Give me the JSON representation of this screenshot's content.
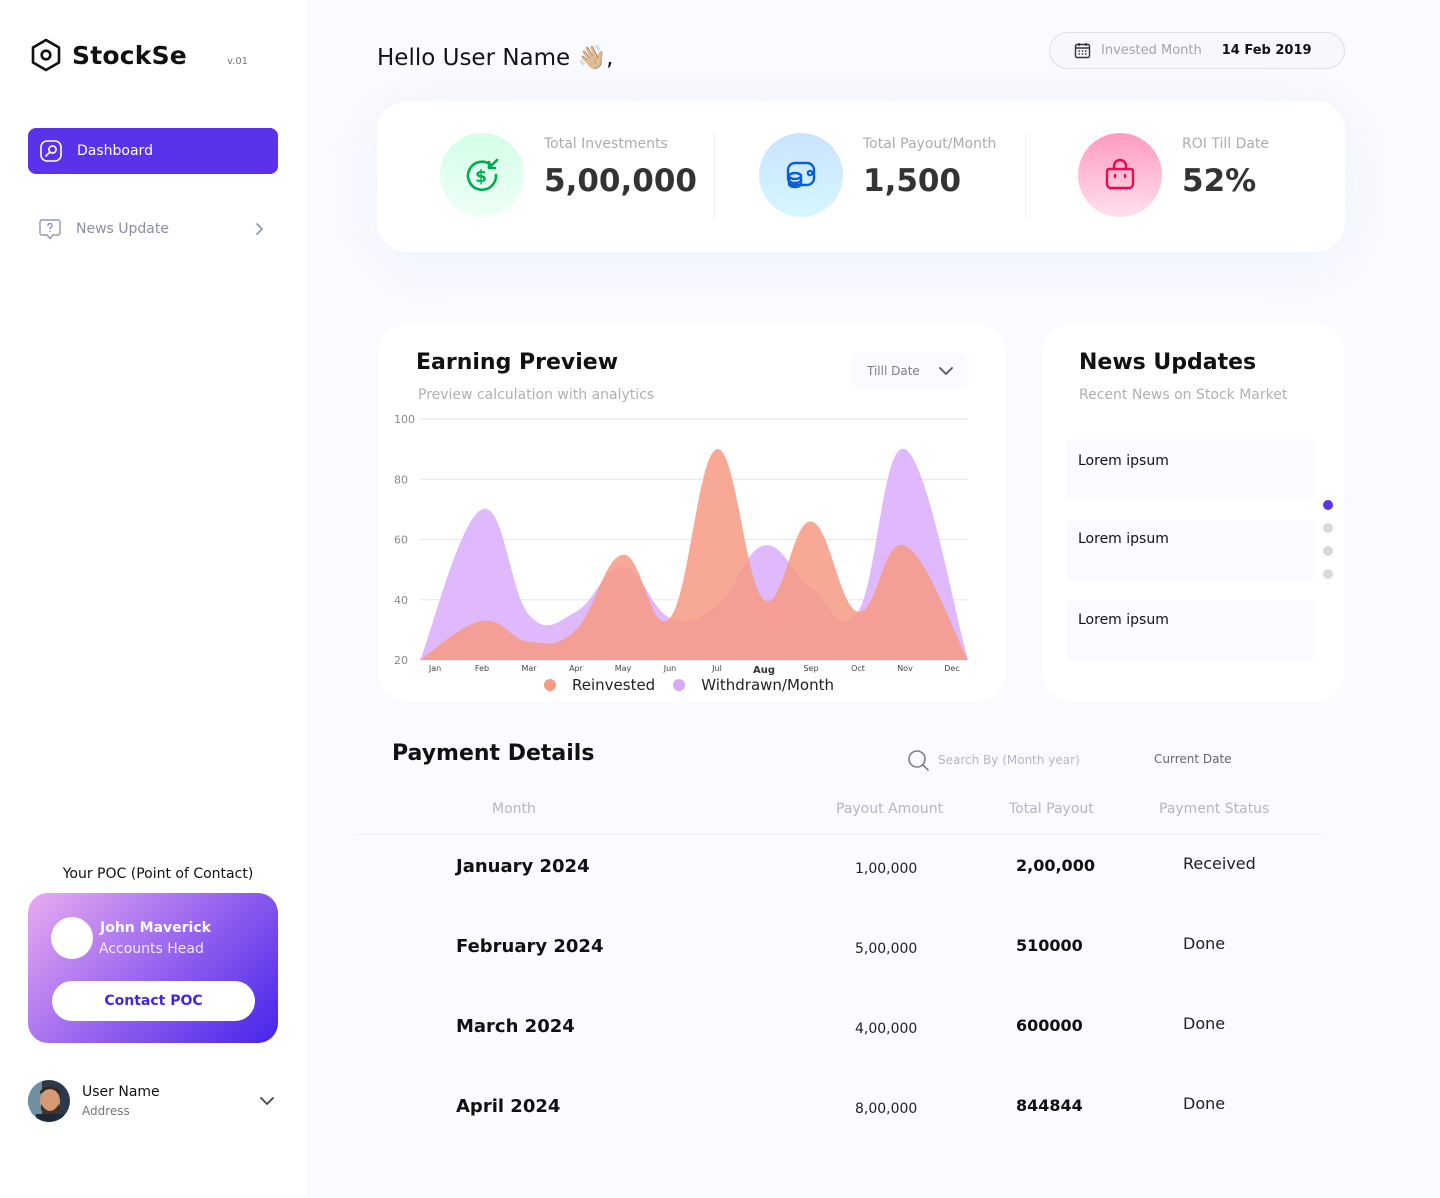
{
  "app": {
    "name": "StockSe",
    "version": "v.01"
  },
  "sidebar": {
    "items": [
      {
        "label": "Dashboard",
        "icon": "dashboard-icon",
        "active": true
      },
      {
        "label": "News Update",
        "icon": "question-chat-icon",
        "active": false
      }
    ],
    "poc": {
      "title": "Your POC (Point of Contact)",
      "name": "John Maverick",
      "role": "Accounts Head",
      "button": "Contact POC"
    },
    "user": {
      "name": "User Name",
      "address": "Address"
    }
  },
  "header": {
    "greeting": "Hello User Name 👋🏼,",
    "date_label": "Invested Month",
    "date_value": "14 Feb 2019"
  },
  "stats": [
    {
      "label": "Total Investments",
      "value": "5,00,000",
      "icon": "dollar-return-icon",
      "color": "#00ac4f"
    },
    {
      "label": "Total Payout/Month",
      "value": "1,500",
      "icon": "coins-icon",
      "color": "#0a5fd6"
    },
    {
      "label": "ROI Till Date",
      "value": "52%",
      "icon": "shopping-bag-icon",
      "color": "#ea0b4c"
    }
  ],
  "earning": {
    "title": "Earning Preview",
    "subtitle": "Preview calculation with analytics",
    "dropdown": "Tilll Date"
  },
  "chart_data": {
    "type": "area",
    "categories": [
      "Jan",
      "Feb",
      "Mar",
      "Apr",
      "May",
      "Jun",
      "Jul",
      "Aug",
      "Sep",
      "Oct",
      "Nov",
      "Dec"
    ],
    "highlight_category": "Aug",
    "y_ticks": [
      100,
      80,
      60,
      40,
      20
    ],
    "ylim": [
      20,
      100
    ],
    "grid": true,
    "legend_position": "bottom",
    "series": [
      {
        "name": "Reinvested",
        "color": "#f79a83",
        "values": [
          20,
          33,
          26,
          30,
          55,
          34,
          90,
          40,
          66,
          36,
          58,
          20
        ]
      },
      {
        "name": "Withdrawn/Month",
        "color": "#d7a8fa",
        "values": [
          20,
          70,
          35,
          36,
          51,
          34,
          38,
          58,
          44,
          36,
          90,
          20
        ]
      }
    ]
  },
  "news": {
    "title": "News Updates",
    "subtitle": "Recent News on Stock Market",
    "items": [
      "Lorem ipsum",
      "Lorem ipsum",
      "Lorem ipsum"
    ],
    "pager_count": 4,
    "pager_active": 0
  },
  "payments": {
    "title": "Payment Details",
    "search_placeholder": "Search By (Month year)",
    "current_date_label": "Current Date",
    "columns": [
      "Month",
      "Payout Amount",
      "Total Payout",
      "Payment Status"
    ],
    "rows": [
      {
        "month": "January 2024",
        "amount": "1,00,000",
        "total": "2,00,000",
        "status": "Received"
      },
      {
        "month": "February 2024",
        "amount": "5,00,000",
        "total": "510000",
        "status": "Done"
      },
      {
        "month": "March 2024",
        "amount": "4,00,000",
        "total": "600000",
        "status": "Done"
      },
      {
        "month": "April 2024",
        "amount": "8,00,000",
        "total": "844844",
        "status": "Done"
      }
    ]
  }
}
